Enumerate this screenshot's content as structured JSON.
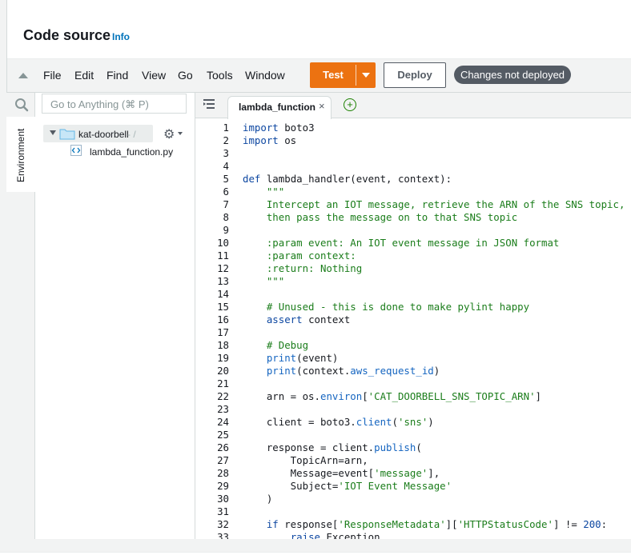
{
  "header": {
    "title": "Code source",
    "info": "Info"
  },
  "menu": {
    "items": [
      "File",
      "Edit",
      "Find",
      "View",
      "Go",
      "Tools",
      "Window"
    ],
    "test_label": "Test",
    "deploy_label": "Deploy",
    "status_badge": "Changes not deployed"
  },
  "sidebar": {
    "search_placeholder": "Go to Anything (⌘ P)",
    "environment_tab": "Environment",
    "folder": "kat-doorbell",
    "folder_suffix": "- /",
    "file": "lambda_function.py"
  },
  "editor": {
    "tab_label": "lambda_function",
    "code_lines": [
      [
        [
          "kw",
          "import"
        ],
        [
          "",
          "boto3"
        ]
      ],
      [
        [
          "kw",
          "import"
        ],
        [
          "",
          "os"
        ]
      ],
      [],
      [],
      [
        [
          "kw",
          "def"
        ],
        [
          "",
          " lambda_handler(event, context):"
        ]
      ],
      [
        [
          "doc",
          "    \"\"\""
        ]
      ],
      [
        [
          "doc",
          "    Intercept an IOT message, retrieve the ARN of the SNS topic,"
        ]
      ],
      [
        [
          "doc",
          "    then pass the message on to that SNS topic"
        ]
      ],
      [],
      [
        [
          "doc",
          "    :param event: An IOT event message in JSON format"
        ]
      ],
      [
        [
          "doc",
          "    :param context:"
        ]
      ],
      [
        [
          "doc",
          "    :return: Nothing"
        ]
      ],
      [
        [
          "doc",
          "    \"\"\""
        ]
      ],
      [],
      [
        [
          "com",
          "    # Unused - this is done to make pylint happy"
        ]
      ],
      [
        [
          "",
          "    "
        ],
        [
          "kw",
          "assert"
        ],
        [
          "",
          " context"
        ]
      ],
      [],
      [
        [
          "com",
          "    # Debug"
        ]
      ],
      [
        [
          "",
          "    "
        ],
        [
          "fn",
          "print"
        ],
        [
          "",
          "(event)"
        ]
      ],
      [
        [
          "",
          "    "
        ],
        [
          "fn",
          "print"
        ],
        [
          "",
          "(context."
        ],
        [
          "fn",
          "aws_request_id"
        ],
        [
          "",
          ")"
        ]
      ],
      [],
      [
        [
          "",
          "    arn = os."
        ],
        [
          "fn",
          "environ"
        ],
        [
          "",
          "["
        ],
        [
          "str",
          "'CAT_DOORBELL_SNS_TOPIC_ARN'"
        ],
        [
          "",
          "]"
        ]
      ],
      [],
      [
        [
          "",
          "    client = boto3."
        ],
        [
          "fn",
          "client"
        ],
        [
          "",
          "("
        ],
        [
          "str",
          "'sns'"
        ],
        [
          "",
          ")"
        ]
      ],
      [],
      [
        [
          "",
          "    response = client."
        ],
        [
          "fn",
          "publish"
        ],
        [
          "",
          "("
        ]
      ],
      [
        [
          "",
          "        TopicArn=arn,"
        ]
      ],
      [
        [
          "",
          "        Message=event["
        ],
        [
          "str",
          "'message'"
        ],
        [
          "",
          "],"
        ]
      ],
      [
        [
          "",
          "        Subject="
        ],
        [
          "str",
          "'IOT Event Message'"
        ]
      ],
      [
        [
          "",
          "    )"
        ]
      ],
      [],
      [
        [
          "",
          "    "
        ],
        [
          "kw",
          "if"
        ],
        [
          "",
          " response["
        ],
        [
          "str",
          "'ResponseMetadata'"
        ],
        [
          "",
          "]["
        ],
        [
          "str",
          "'HTTPStatusCode'"
        ],
        [
          "",
          "] != "
        ],
        [
          "num",
          "200"
        ],
        [
          "",
          ":"
        ]
      ],
      [
        [
          "",
          "        "
        ],
        [
          "kw",
          "raise"
        ],
        [
          "",
          " Exception"
        ]
      ]
    ]
  },
  "colors": {
    "accent": "#ec7211",
    "badge": "#545b64",
    "link": "#0073bb"
  }
}
